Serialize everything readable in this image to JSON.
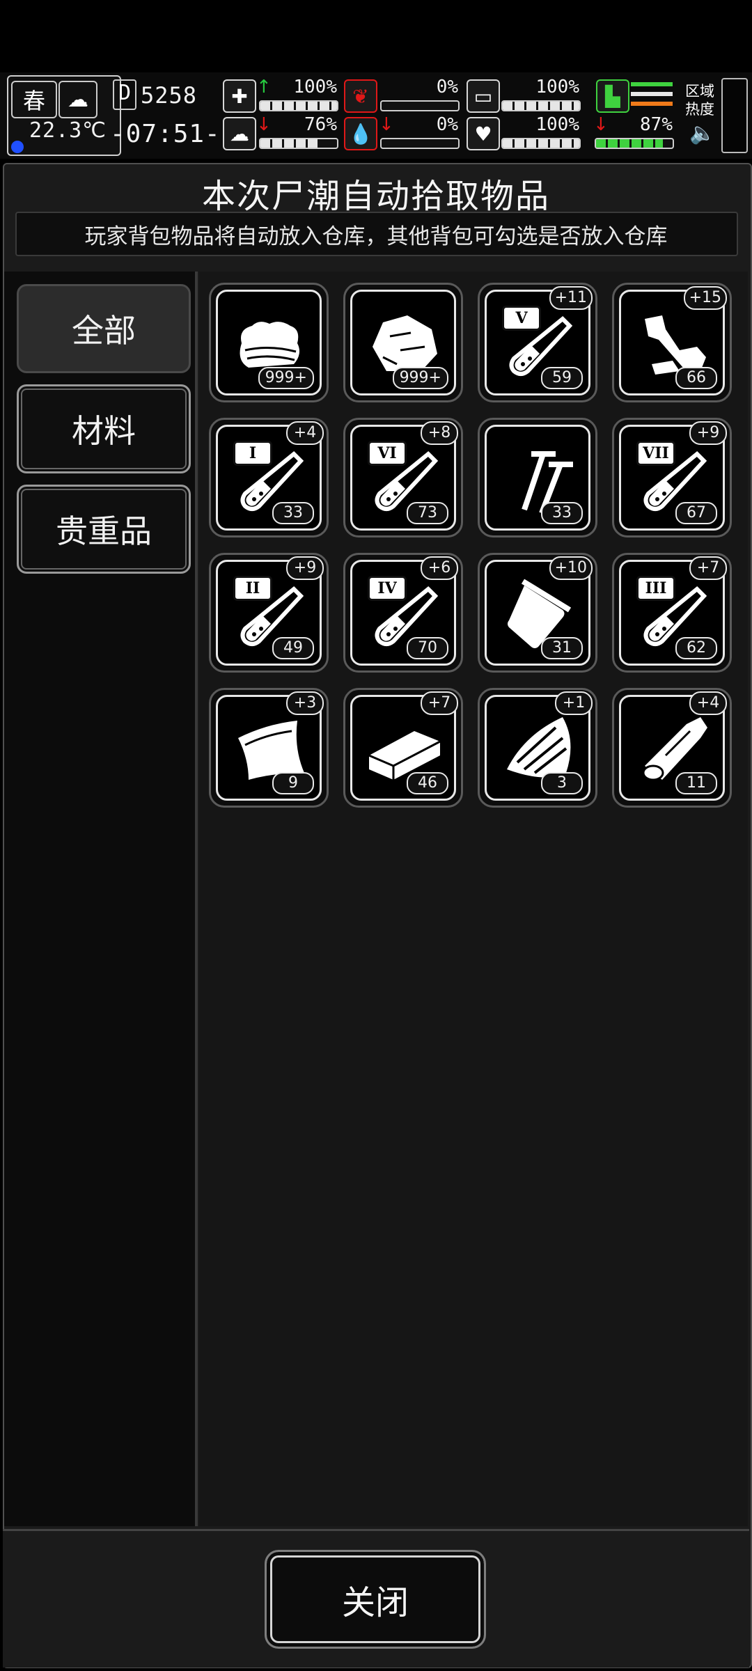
{
  "hud": {
    "season": "春",
    "temperature": "22.3℃",
    "day": "5258",
    "time": "-07:51-",
    "health_pct": "100%",
    "stomach_pct": "0%",
    "stamina_pct": "100%",
    "brain_pct": "76%",
    "water_pct": "0%",
    "heart_pct": "100%",
    "leg_pct": "87%",
    "zone_heat_label": "区域\n热度",
    "stats": {
      "health": 1.0,
      "stomach": 0.0,
      "stamina": 1.0,
      "brain": 0.76,
      "water": 0.0,
      "heart": 1.0,
      "leg": 0.87
    }
  },
  "dialog": {
    "title": "本次尸潮自动拾取物品",
    "subtitle": "玩家背包物品将自动放入仓库，其他背包可勾选是否放入仓库"
  },
  "tabs": [
    {
      "label": "全部",
      "active": true
    },
    {
      "label": "材料",
      "active": false
    },
    {
      "label": "贵重品",
      "active": false
    }
  ],
  "items": [
    {
      "icon": "cloth-icon",
      "count": "999+",
      "bonus": ""
    },
    {
      "icon": "stone-icon",
      "count": "999+",
      "bonus": ""
    },
    {
      "icon": "test-tube-icon",
      "tier": "V",
      "count": "59",
      "bonus": "+11"
    },
    {
      "icon": "scrap-pipe-icon",
      "count": "66",
      "bonus": "+15"
    },
    {
      "icon": "test-tube-icon",
      "tier": "I",
      "count": "33",
      "bonus": "+4"
    },
    {
      "icon": "test-tube-icon",
      "tier": "VI",
      "count": "73",
      "bonus": "+8"
    },
    {
      "icon": "nails-icon",
      "count": "33",
      "bonus": ""
    },
    {
      "icon": "test-tube-icon",
      "tier": "VII",
      "count": "67",
      "bonus": "+9"
    },
    {
      "icon": "test-tube-icon",
      "tier": "II",
      "count": "49",
      "bonus": "+9"
    },
    {
      "icon": "test-tube-icon",
      "tier": "IV",
      "count": "70",
      "bonus": "+6"
    },
    {
      "icon": "plastic-bag-icon",
      "count": "31",
      "bonus": "+10"
    },
    {
      "icon": "test-tube-icon",
      "tier": "III",
      "count": "62",
      "bonus": "+7"
    },
    {
      "icon": "leather-icon",
      "count": "9",
      "bonus": "+3"
    },
    {
      "icon": "wood-plank-icon",
      "count": "46",
      "bonus": "+7"
    },
    {
      "icon": "bark-icon",
      "count": "3",
      "bonus": "+1"
    },
    {
      "icon": "log-icon",
      "count": "11",
      "bonus": "+4"
    }
  ],
  "close_label": "关闭",
  "colors": {
    "up": "#27c93f",
    "down": "#e01818",
    "stamina_green": "#3fd23f"
  }
}
